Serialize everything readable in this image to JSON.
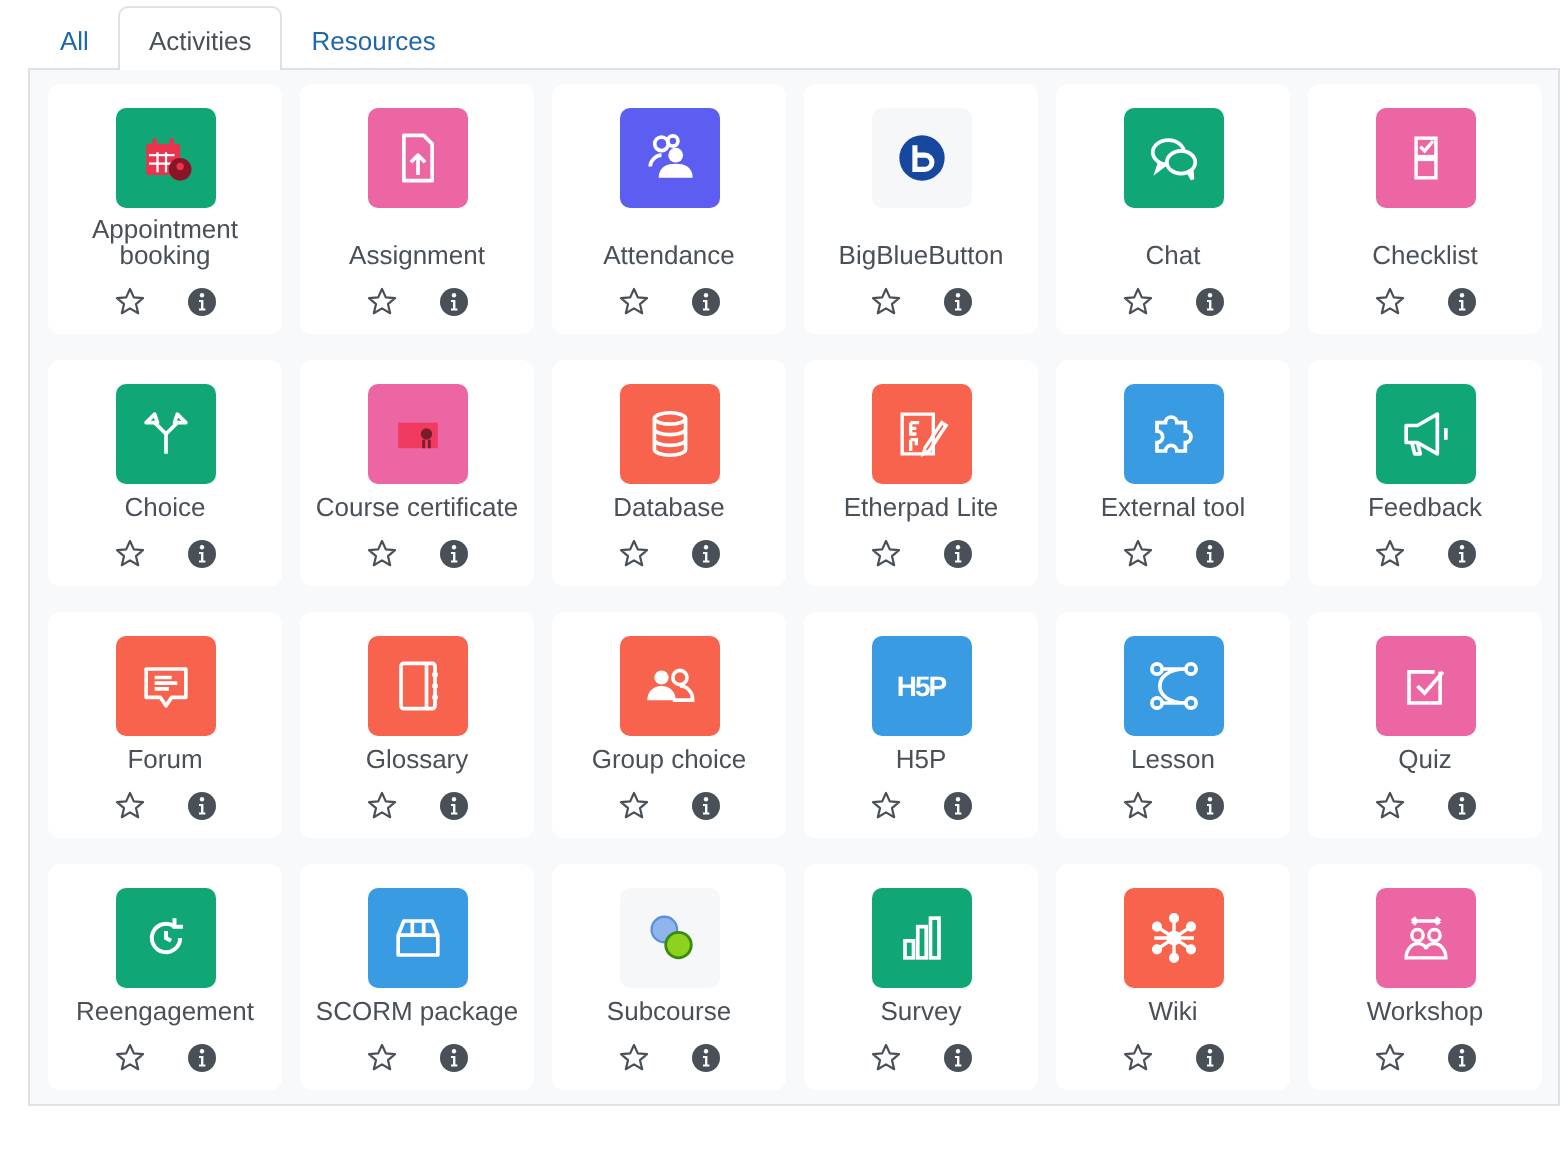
{
  "tabs": [
    {
      "label": "All",
      "selected": false
    },
    {
      "label": "Activities",
      "selected": true
    },
    {
      "label": "Resources",
      "selected": false
    }
  ],
  "items": [
    {
      "name": "Appointment booking",
      "color": "#11a676",
      "kind": "calendar",
      "starred": false
    },
    {
      "name": "Assignment",
      "color": "#eb66a2",
      "kind": "file-upload",
      "starred": false
    },
    {
      "name": "Attendance",
      "color": "#5b5ef0",
      "kind": "people",
      "starred": false
    },
    {
      "name": "BigBlueButton",
      "color": "#f5f7f9",
      "kind": "round-logo",
      "starred": false
    },
    {
      "name": "Chat",
      "color": "#11a676",
      "kind": "chat",
      "starred": false
    },
    {
      "name": "Checklist",
      "color": "#eb66a2",
      "kind": "checklist",
      "starred": false
    },
    {
      "name": "Choice",
      "color": "#11a676",
      "kind": "signpost",
      "starred": false
    },
    {
      "name": "Course certificate",
      "color": "#eb66a2",
      "kind": "certificate",
      "starred": false
    },
    {
      "name": "Database",
      "color": "#f7634d",
      "kind": "database",
      "starred": false
    },
    {
      "name": "Etherpad Lite",
      "color": "#f7634d",
      "kind": "pad",
      "starred": false
    },
    {
      "name": "External tool",
      "color": "#399be2",
      "kind": "puzzle",
      "starred": false
    },
    {
      "name": "Feedback",
      "color": "#11a676",
      "kind": "megaphone",
      "starred": false
    },
    {
      "name": "Forum",
      "color": "#f7634d",
      "kind": "forum",
      "starred": false
    },
    {
      "name": "Glossary",
      "color": "#f7634d",
      "kind": "book",
      "starred": false
    },
    {
      "name": "Group choice",
      "color": "#f7634d",
      "kind": "group",
      "starred": false
    },
    {
      "name": "H5P",
      "color": "#399be2",
      "kind": "logo-text",
      "icon_text": "H5P",
      "starred": false
    },
    {
      "name": "Lesson",
      "color": "#399be2",
      "kind": "path",
      "starred": false
    },
    {
      "name": "Quiz",
      "color": "#eb66a2",
      "kind": "quiz",
      "starred": false
    },
    {
      "name": "Reengagement",
      "color": "#11a676",
      "kind": "clock",
      "starred": false
    },
    {
      "name": "SCORM package",
      "color": "#399be2",
      "kind": "box",
      "starred": false
    },
    {
      "name": "Subcourse",
      "color": "#f5f7f9",
      "kind": "circles",
      "starred": false
    },
    {
      "name": "Survey",
      "color": "#11a676",
      "kind": "bars",
      "starred": false
    },
    {
      "name": "Wiki",
      "color": "#f7634d",
      "kind": "network",
      "starred": false
    },
    {
      "name": "Workshop",
      "color": "#eb66a2",
      "kind": "workshop",
      "starred": false
    }
  ]
}
